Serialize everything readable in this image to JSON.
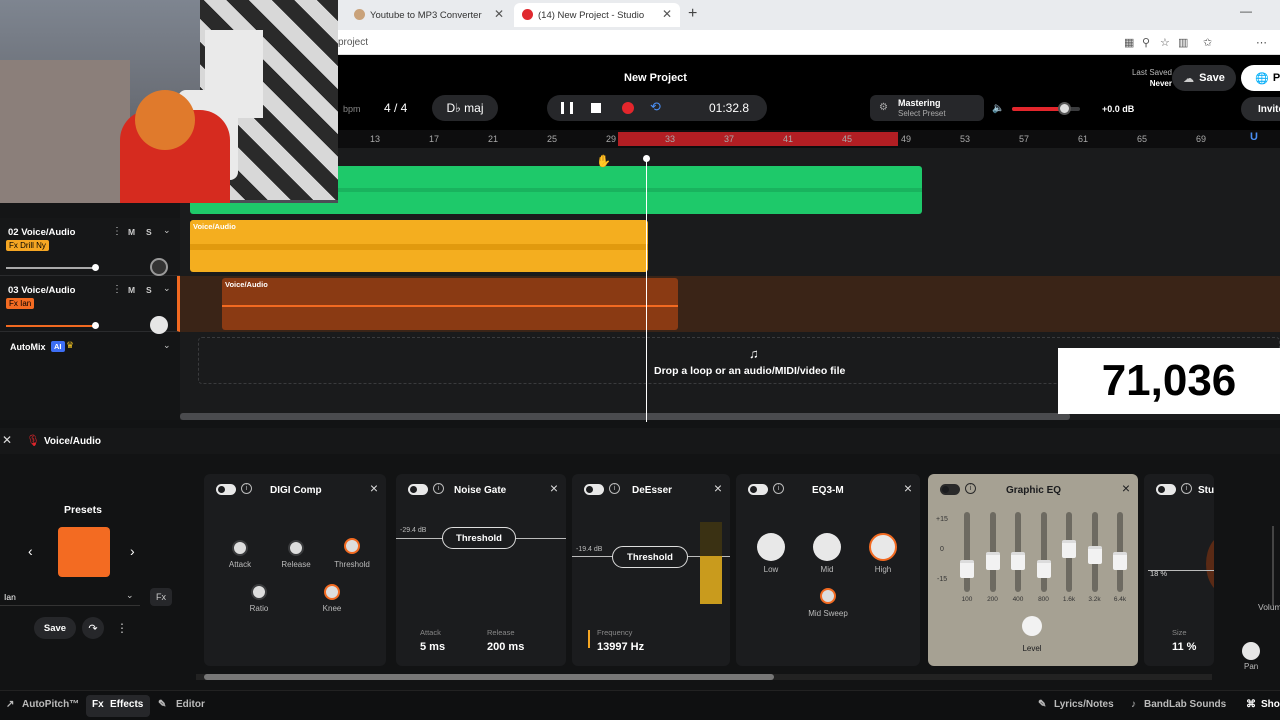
{
  "browser": {
    "tabs": [
      {
        "title": "Youtube to MP3 Converter"
      },
      {
        "title": "(14) New Project - Studio"
      }
    ],
    "address": "project"
  },
  "project": {
    "title": "New Project",
    "last_saved_label": "Last Saved",
    "last_saved_value": "Never",
    "save_label": "Save",
    "publish_label": "Pu",
    "invite_label": "Invite"
  },
  "transport": {
    "bpm_label": "bpm",
    "time_signature": "4 / 4",
    "key": "D♭ maj",
    "time": "01:32.8"
  },
  "mastering": {
    "label": "Mastering",
    "preset": "Select Preset"
  },
  "volume": {
    "level": 0.78,
    "db": "+0.0 dB"
  },
  "ruler": [
    "13",
    "17",
    "21",
    "25",
    "29",
    "33",
    "37",
    "41",
    "45",
    "49",
    "53",
    "57",
    "61",
    "65",
    "69"
  ],
  "tracks": [
    {
      "name": "02 Voice/Audio",
      "fx": "Fx Drill Ny",
      "fx_color": "#f5a623",
      "clip_label": "Voice/Audio",
      "color": "#f4ae1f"
    },
    {
      "name": "03 Voice/Audio",
      "fx": "Fx Ian",
      "fx_color": "#f36b22",
      "clip_label": "Voice/Audio",
      "color": "#f26a21"
    }
  ],
  "ms": {
    "m": "M",
    "s": "S"
  },
  "automix": {
    "label": "AutoMix",
    "ai": "AI"
  },
  "drop": {
    "text": "Drop a loop or an audio/MIDI/video file"
  },
  "overlay_number": "71,036",
  "fx_header": {
    "title": "Voice/Audio"
  },
  "presets": {
    "title": "Presets",
    "selected": "Ian",
    "save_label": "Save"
  },
  "effects": [
    {
      "title": "DIGI Comp",
      "knobs": [
        "Attack",
        "Release",
        "Threshold",
        "Ratio",
        "Knee"
      ]
    },
    {
      "title": "Noise Gate",
      "threshold_db": "-29.4 dB",
      "threshold_label": "Threshold",
      "attack_label": "Attack",
      "attack_value": "5 ms",
      "release_label": "Release",
      "release_value": "200 ms"
    },
    {
      "title": "DeEsser",
      "threshold_db": "-19.4 dB",
      "threshold_label": "Threshold",
      "freq_label": "Frequency",
      "freq_value": "13997 Hz"
    },
    {
      "title": "EQ3-M",
      "knobs": [
        "Low",
        "Mid",
        "High",
        "Mid Sweep"
      ]
    },
    {
      "title": "Graphic EQ",
      "scale": [
        "+15",
        "0",
        "-15"
      ],
      "bands": [
        "100",
        "200",
        "400",
        "800",
        "1.6k",
        "3.2k",
        "6.4k"
      ],
      "level_label": "Level"
    },
    {
      "title": "Stu",
      "pct_left": "18 %",
      "size_label": "Size",
      "size_value": "11 %"
    }
  ],
  "right_strip": {
    "volume": "Volum",
    "pan": "Pan"
  },
  "bottombar": {
    "autopitch": "AutoPitch™",
    "effects": "Effects",
    "editor": "Editor",
    "lyrics": "Lyrics/Notes",
    "sounds": "BandLab Sounds",
    "show": "Sho"
  }
}
